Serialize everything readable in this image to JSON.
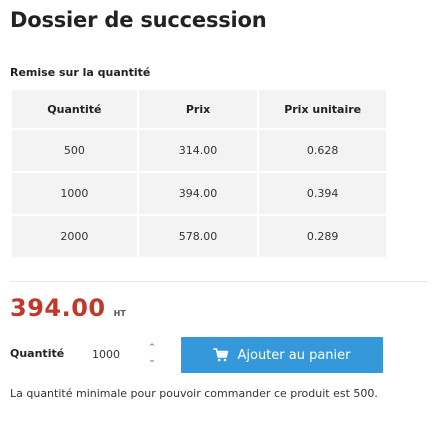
{
  "page": {
    "title": "Dossier de succession"
  },
  "discount": {
    "section_title": "Remise sur la quantité",
    "columns": [
      "Quantité",
      "Prix",
      "Prix unitaire"
    ],
    "rows": [
      [
        "500",
        "314.00",
        "0.628"
      ],
      [
        "1000",
        "394.00",
        "0.394"
      ],
      [
        "2000",
        "578.00",
        "0.289"
      ]
    ]
  },
  "price": {
    "value": "394.00",
    "tax_label": "HT",
    "color": "#c0392b"
  },
  "order": {
    "quantity_label": "Quantité",
    "quantity_value": "1000",
    "stepper_up_icon": "chevron-up-icon",
    "stepper_down_icon": "chevron-down-icon",
    "add_to_cart_label": "Ajouter au panier",
    "add_to_cart_icon": "cart-icon",
    "button_color": "#3498db",
    "min_note": "La quantité minimale pour pouvoir commander ce produit est 500."
  }
}
